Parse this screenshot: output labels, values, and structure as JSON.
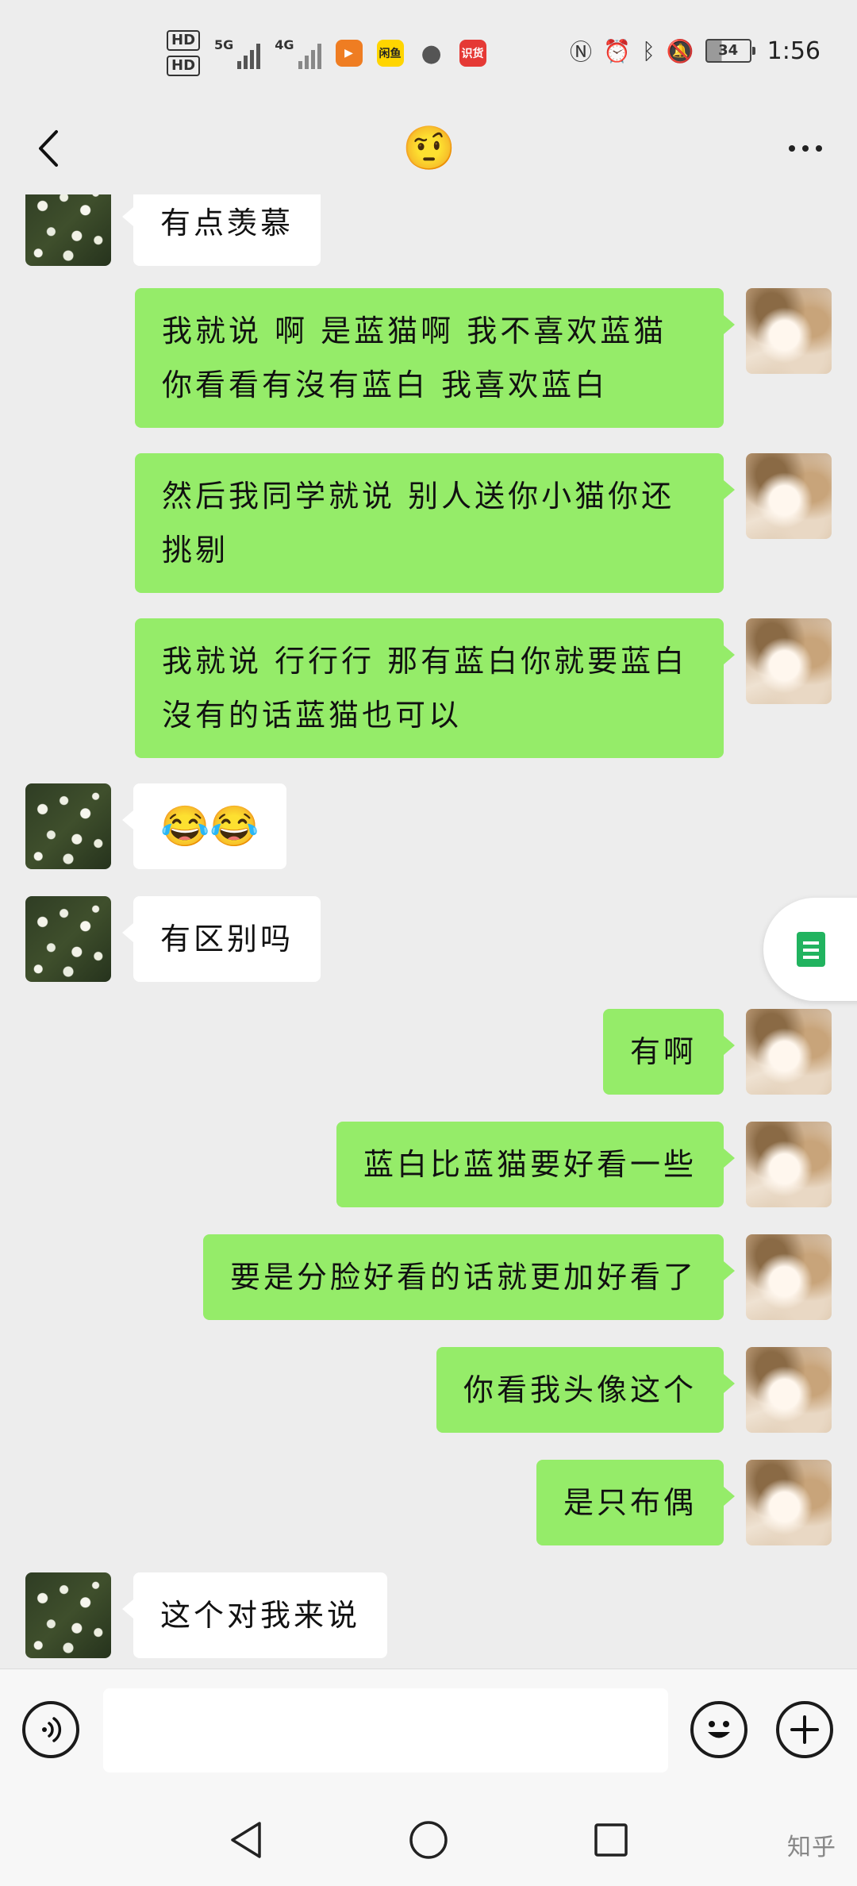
{
  "status_bar": {
    "hd1": "HD",
    "hd2": "HD",
    "net1": "5G",
    "net2": "4G",
    "app_icons": [
      {
        "label": "",
        "color": "#ef7d22"
      },
      {
        "label": "闲鱼",
        "color": "#ffd500"
      },
      {
        "label": "",
        "color": "#555555"
      },
      {
        "label": "识货",
        "color": "#e53935"
      }
    ],
    "battery": "34",
    "time": "1:56"
  },
  "header": {
    "title_emoji": "🤨"
  },
  "messages": [
    {
      "side": "in",
      "text": "有点羡慕"
    },
    {
      "side": "out",
      "text": "我就说 啊 是蓝猫啊 我不喜欢蓝猫 你看看有沒有蓝白 我喜欢蓝白"
    },
    {
      "side": "out",
      "text": "然后我同学就说 别人送你小猫你还挑剔"
    },
    {
      "side": "out",
      "text": "我就说 行行行 那有蓝白你就要蓝白 沒有的话蓝猫也可以"
    },
    {
      "side": "in",
      "text": "😂😂"
    },
    {
      "side": "in",
      "text": "有区别吗"
    },
    {
      "side": "out",
      "text": "有啊"
    },
    {
      "side": "out",
      "text": "蓝白比蓝猫要好看一些"
    },
    {
      "side": "out",
      "text": "要是分脸好看的话就更加好看了"
    },
    {
      "side": "out",
      "text": "你看我头像这个"
    },
    {
      "side": "out",
      "text": "是只布偶"
    },
    {
      "side": "in",
      "text": "这个对我来说"
    }
  ],
  "input": {
    "value": "",
    "placeholder": ""
  },
  "watermark": "知乎"
}
